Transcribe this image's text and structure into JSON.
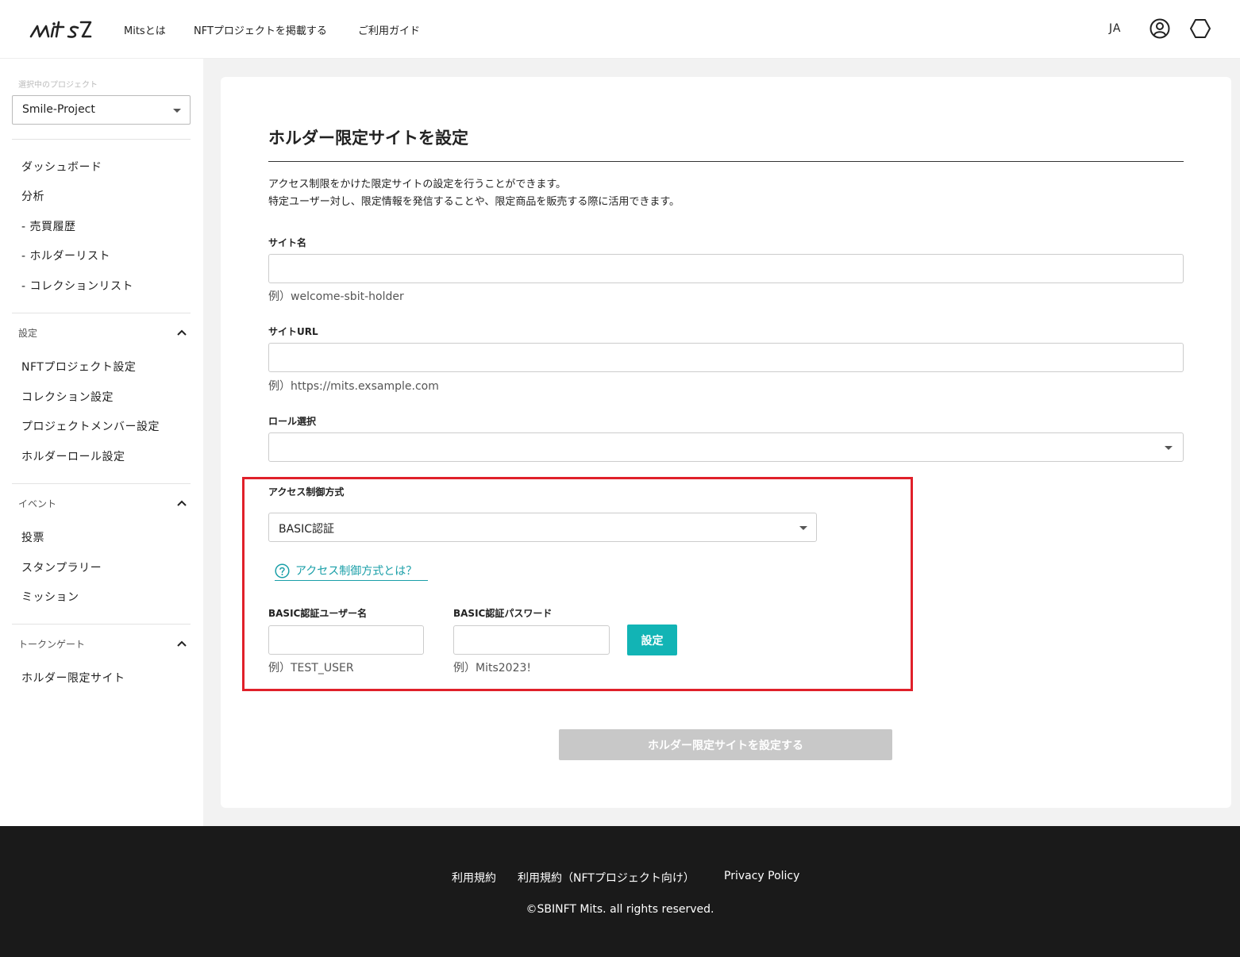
{
  "header": {
    "logo_text": "mits",
    "nav": [
      "Mitsとは",
      "NFTプロジェクトを掲載する",
      "ご利用ガイド"
    ],
    "lang": "JA"
  },
  "sidebar": {
    "caption": "選択中のプロジェクト",
    "project": "Smile-Project",
    "main_items": [
      "ダッシュボード",
      "分析",
      "- 売買履歴",
      "- ホルダーリスト",
      "- コレクションリスト"
    ],
    "sections": [
      {
        "title": "設定",
        "items": [
          "NFTプロジェクト設定",
          "コレクション設定",
          "プロジェクトメンバー設定",
          "ホルダーロール設定"
        ]
      },
      {
        "title": "イベント",
        "items": [
          "投票",
          "スタンプラリー",
          "ミッション"
        ]
      },
      {
        "title": "トークンゲート",
        "items": [
          "ホルダー限定サイト"
        ]
      }
    ]
  },
  "main": {
    "title": "ホルダー限定サイトを設定",
    "desc_1": "アクセス制限をかけた限定サイトの設定を行うことができます。",
    "desc_2": "特定ユーザー対し、限定情報を発信することや、限定商品を販売する際に活用できます。",
    "site_name": {
      "label": "サイト名",
      "value": "",
      "hint": "例）welcome-sbit-holder"
    },
    "site_url": {
      "label": "サイトURL",
      "value": "",
      "hint": "例）https://mits.exsample.com"
    },
    "role": {
      "label": "ロール選択",
      "value": ""
    },
    "access": {
      "label": "アクセス制御方式",
      "value": "BASIC認証",
      "help": "アクセス制御方式とは？",
      "user": {
        "label": "BASIC認証ユーザー名",
        "value": "",
        "hint": "例）TEST_USER"
      },
      "password": {
        "label": "BASIC認証パスワード",
        "value": "",
        "hint": "例）Mits2023!"
      },
      "set_button": "設定"
    },
    "submit": "ホルダー限定サイトを設定する"
  },
  "footer": {
    "links": [
      "利用規約",
      "利用規約（NFTプロジェクト向け）",
      "Privacy Policy"
    ],
    "copyright": "©SBINFT Mits. all rights reserved."
  },
  "colors": {
    "accent": "#12b4b5",
    "link": "#1a9fa8",
    "highlight": "#e0202a",
    "footer": "#1a1a1a",
    "disabled": "#c8c8c8"
  }
}
